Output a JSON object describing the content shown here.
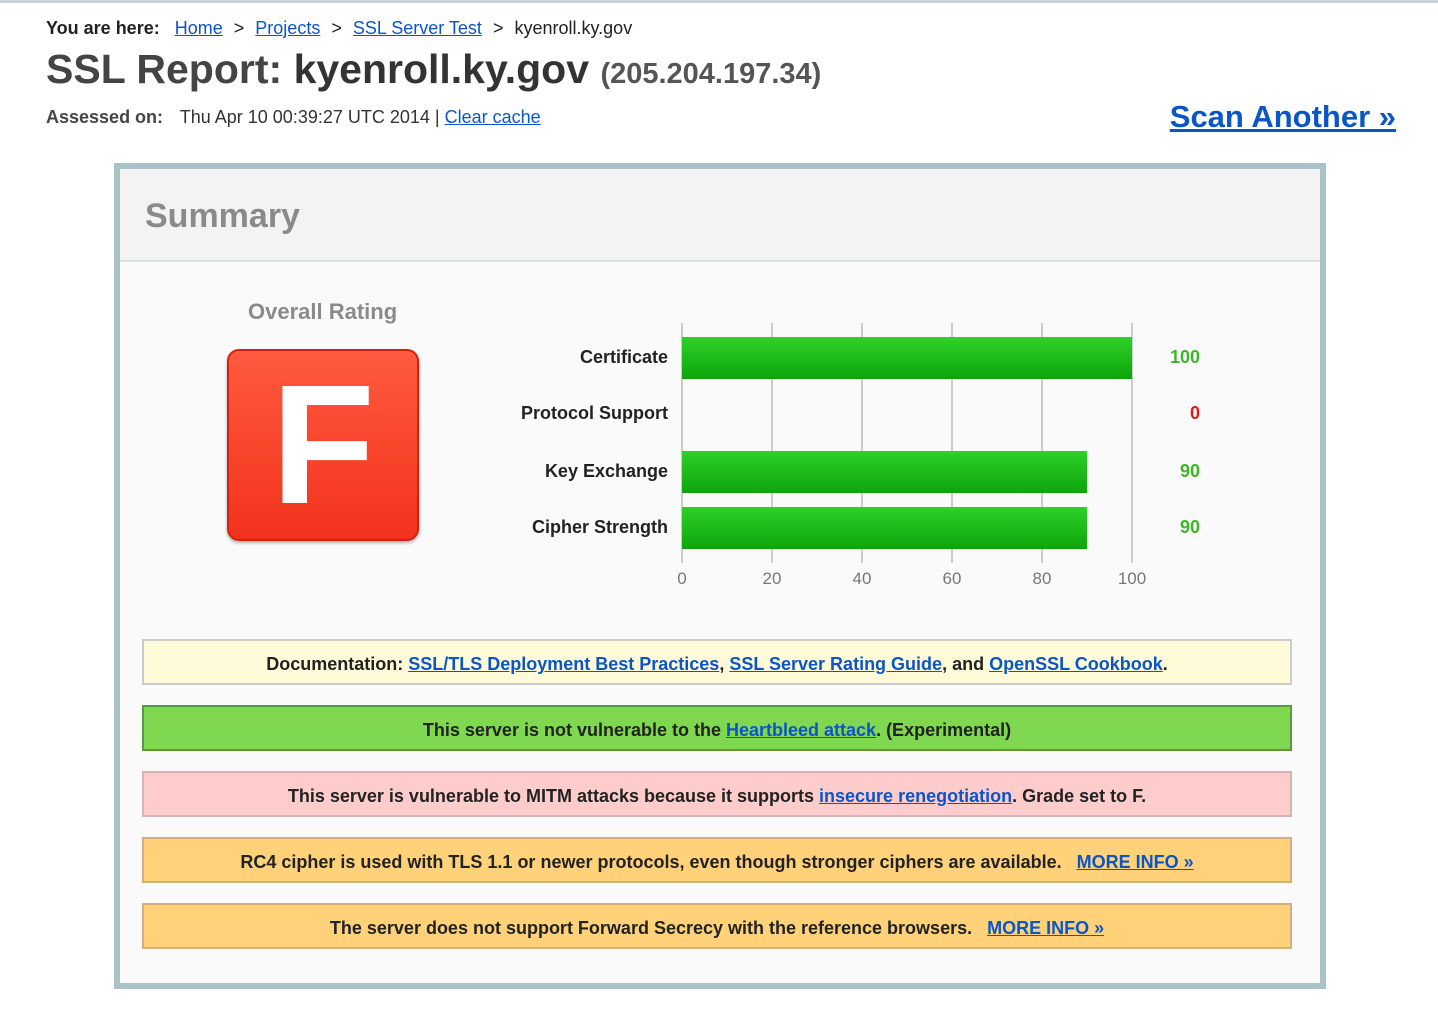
{
  "breadcrumb": {
    "label": "You are here:",
    "items": [
      "Home",
      "Projects",
      "SSL Server Test"
    ],
    "current": "kyenroll.ky.gov",
    "separator": ">"
  },
  "report": {
    "title_prefix": "SSL Report:",
    "host": "kyenroll.ky.gov",
    "ip": "(205.204.197.34)",
    "assessed_label": "Assessed on:",
    "assessed_value": "Thu Apr 10 00:39:27 UTC 2014",
    "assessed_sep": "|",
    "clear_cache": "Clear cache",
    "scan_another": "Scan Another »"
  },
  "summary": {
    "heading": "Summary",
    "overall_label": "Overall Rating",
    "grade": "F",
    "grade_color": "#f2321c"
  },
  "chart_data": {
    "type": "bar",
    "orientation": "horizontal",
    "categories": [
      "Certificate",
      "Protocol Support",
      "Key Exchange",
      "Cipher Strength"
    ],
    "values": [
      100,
      0,
      90,
      90
    ],
    "value_colors": [
      "#3cb826",
      "#e01a1a",
      "#3cb826",
      "#3cb826"
    ],
    "xlim": [
      0,
      100
    ],
    "ticks": [
      0,
      20,
      40,
      60,
      80,
      100
    ],
    "bar_color": "#18b814",
    "grid": true
  },
  "messages": [
    {
      "kind": "doc",
      "parts": [
        {
          "t": "Documentation: "
        },
        {
          "t": "SSL/TLS Deployment Best Practices",
          "link": true
        },
        {
          "t": ", "
        },
        {
          "t": "SSL Server Rating Guide",
          "link": true
        },
        {
          "t": ", and "
        },
        {
          "t": "OpenSSL Cookbook",
          "link": true
        },
        {
          "t": "."
        }
      ]
    },
    {
      "kind": "ok",
      "parts": [
        {
          "t": "This server is not vulnerable to the "
        },
        {
          "t": "Heartbleed attack",
          "link": true
        },
        {
          "t": ". (Experimental)"
        }
      ]
    },
    {
      "kind": "bad",
      "parts": [
        {
          "t": "This server is vulnerable to MITM attacks because it supports "
        },
        {
          "t": "insecure renegotiation",
          "link": true
        },
        {
          "t": ". Grade set to F."
        }
      ]
    },
    {
      "kind": "warn",
      "parts": [
        {
          "t": "RC4 cipher is used with TLS 1.1 or newer protocols, even though stronger ciphers are available. "
        },
        {
          "t": "MORE INFO »",
          "link": true,
          "more": true
        }
      ]
    },
    {
      "kind": "warn",
      "parts": [
        {
          "t": "The server does not support Forward Secrecy with the reference browsers. "
        },
        {
          "t": "MORE INFO »",
          "link": true,
          "more": true
        }
      ]
    }
  ]
}
